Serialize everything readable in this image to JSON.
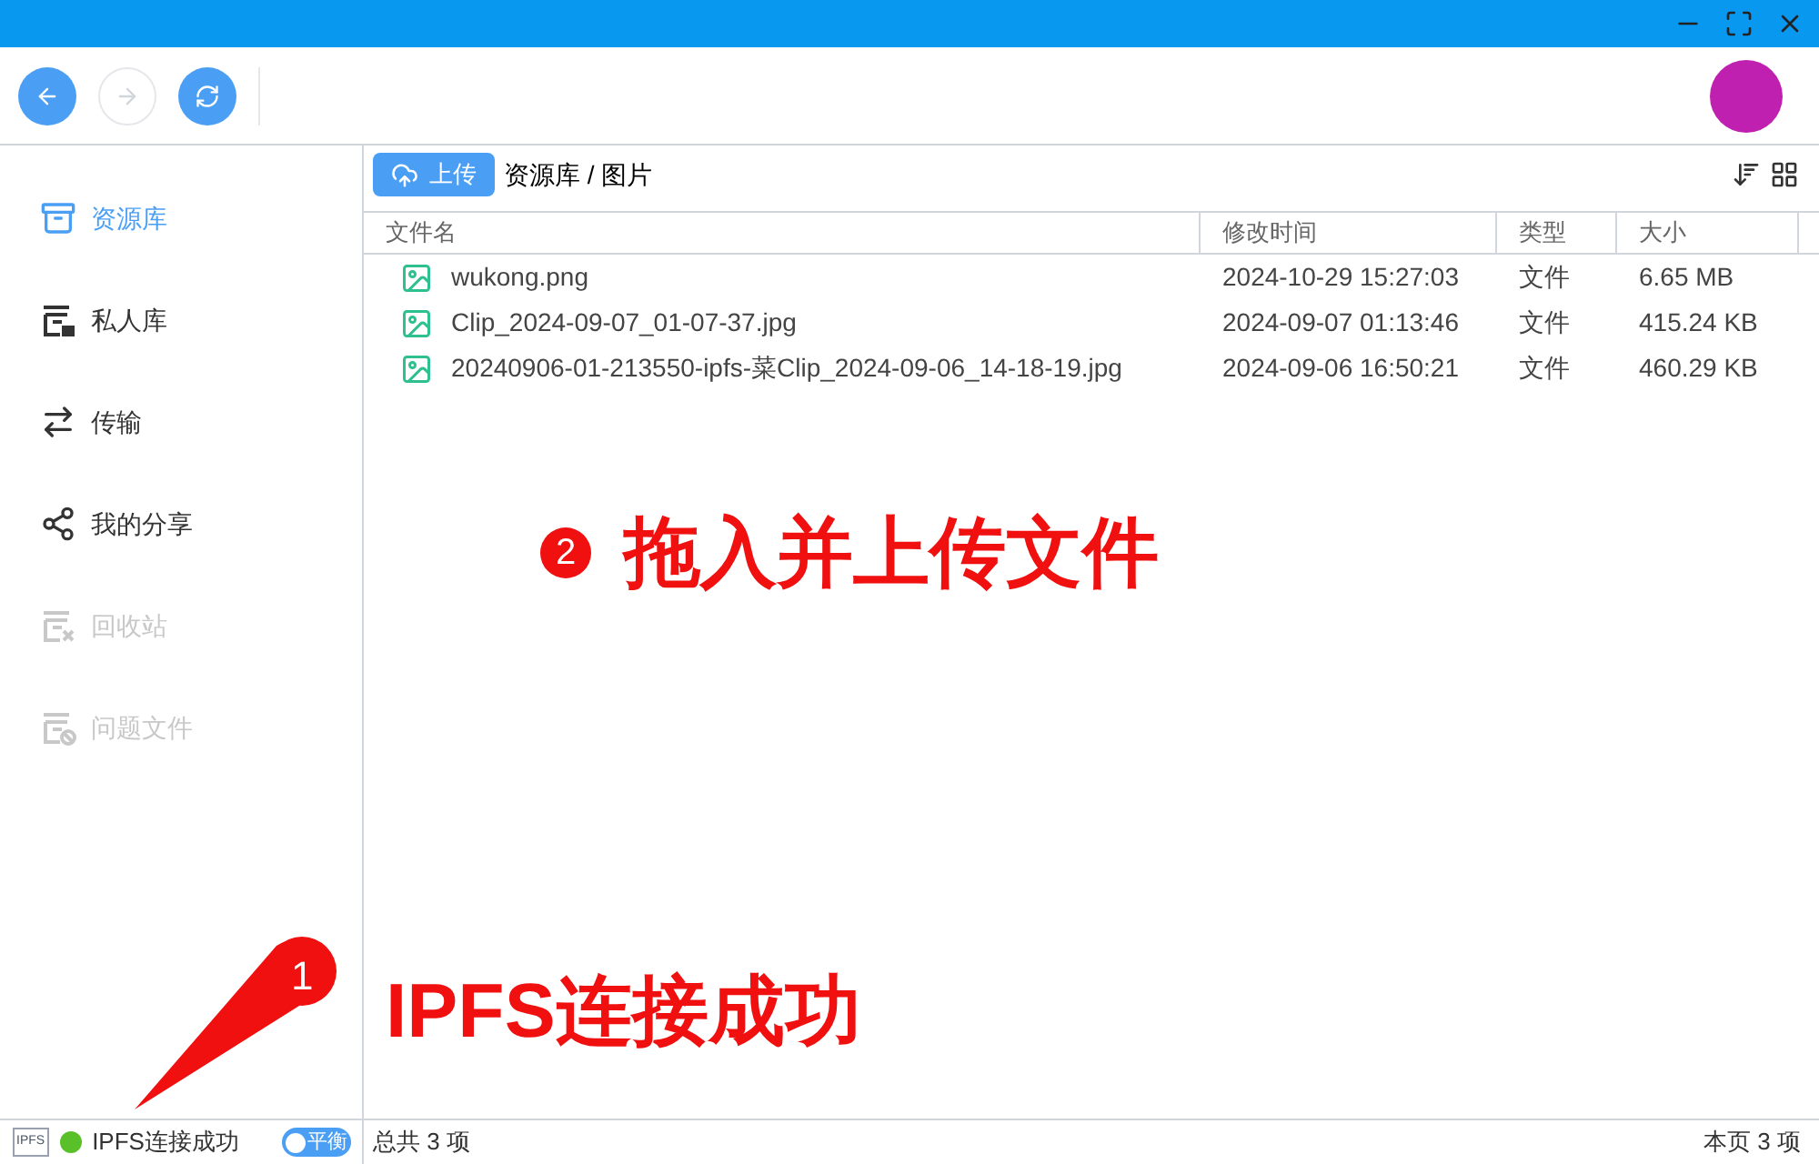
{
  "toolbar": {
    "back": {
      "disabled": false
    },
    "forward": {
      "disabled": true
    },
    "refresh": {
      "disabled": false
    }
  },
  "sidebar": {
    "items": [
      {
        "label": "资源库",
        "kind": "library",
        "selected": true,
        "disabled": false
      },
      {
        "label": "私人库",
        "kind": "private",
        "selected": false,
        "disabled": false
      },
      {
        "label": "传输",
        "kind": "transfer",
        "selected": false,
        "disabled": false
      },
      {
        "label": "我的分享",
        "kind": "share",
        "selected": false,
        "disabled": false
      },
      {
        "label": "回收站",
        "kind": "trash",
        "selected": false,
        "disabled": true
      },
      {
        "label": "问题文件",
        "kind": "problem",
        "selected": false,
        "disabled": true
      }
    ]
  },
  "upload_button": "上传",
  "breadcrumb": "资源库 / 图片",
  "table": {
    "columns": [
      "文件名",
      "修改时间",
      "类型",
      "大小"
    ],
    "rows": [
      {
        "name": "wukong.png",
        "modified": "2024-10-29 15:27:03",
        "type": "文件",
        "size": "6.65 MB"
      },
      {
        "name": "Clip_2024-09-07_01-07-37.jpg",
        "modified": "2024-09-07 01:13:46",
        "type": "文件",
        "size": "415.24 KB"
      },
      {
        "name": "20240906-01-213550-ipfs-菜Clip_2024-09-06_14-18-19.jpg",
        "modified": "2024-09-06 16:50:21",
        "type": "文件",
        "size": "460.29 KB"
      }
    ]
  },
  "status_bar": {
    "ipfs_badge": "IPFS",
    "connection": "IPFS连接成功",
    "connected": true,
    "mode_toggle": {
      "label": "平衡",
      "on": false
    },
    "total": "总共 3 项",
    "page_count": "本页 3 项"
  },
  "annotations": [
    {
      "number": "2",
      "text": "拖入并上传文件"
    },
    {
      "number": "1",
      "text": "IPFS连接成功"
    }
  ]
}
